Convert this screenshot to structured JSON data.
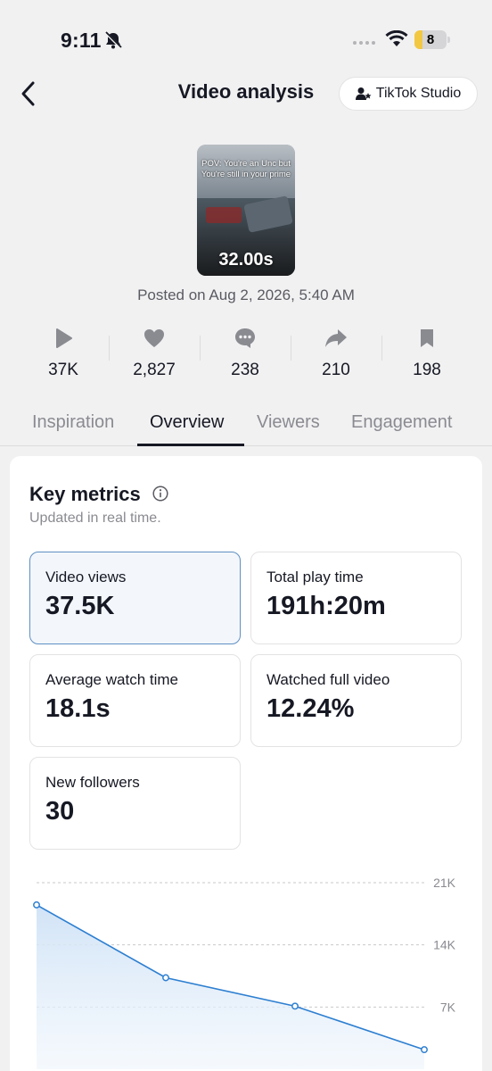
{
  "status_bar": {
    "time": "9:11",
    "battery": "8"
  },
  "header": {
    "title": "Video analysis",
    "studio_button": "TikTok Studio"
  },
  "video": {
    "caption": "POV: You're an Unc but You're still in your prime",
    "duration": "32.00s",
    "posted": "Posted on Aug 2, 2026, 5:40 AM"
  },
  "stats": [
    {
      "icon": "play-icon",
      "value": "37K"
    },
    {
      "icon": "heart-icon",
      "value": "2,827"
    },
    {
      "icon": "comment-icon",
      "value": "238"
    },
    {
      "icon": "share-icon",
      "value": "210"
    },
    {
      "icon": "bookmark-icon",
      "value": "198"
    }
  ],
  "tabs": [
    {
      "label": "Inspiration",
      "active": false
    },
    {
      "label": "Overview",
      "active": true
    },
    {
      "label": "Viewers",
      "active": false
    },
    {
      "label": "Engagement",
      "active": false
    }
  ],
  "key_metrics": {
    "title": "Key metrics",
    "subtitle": "Updated in real time.",
    "items": [
      {
        "label": "Video views",
        "value": "37.5K",
        "selected": true
      },
      {
        "label": "Total play time",
        "value": "191h:20m",
        "selected": false
      },
      {
        "label": "Average watch time",
        "value": "18.1s",
        "selected": false
      },
      {
        "label": "Watched full video",
        "value": "12.24%",
        "selected": false
      },
      {
        "label": "New followers",
        "value": "30",
        "selected": false
      }
    ]
  },
  "colors": {
    "accent_line": "#2d7fd1",
    "selected_border": "#5f8fc2"
  },
  "chart_data": {
    "type": "area",
    "y_ticks": [
      "21K",
      "14K",
      "7K"
    ],
    "y_tick_values": [
      21000,
      14000,
      7000
    ],
    "ylim": [
      0,
      21000
    ],
    "series": [
      {
        "values": [
          18500,
          10300,
          7100,
          2200
        ]
      }
    ],
    "grid": true
  }
}
